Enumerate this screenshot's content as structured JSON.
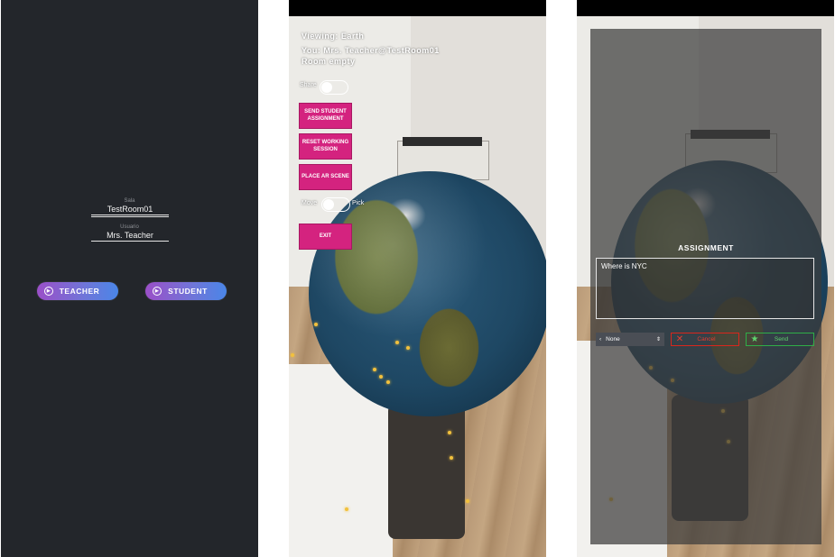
{
  "login": {
    "room_caption": "Sala",
    "room_value": "TestRoom01",
    "user_caption": "Usuario",
    "user_value": "Mrs. Teacher",
    "teacher_button": "TEACHER",
    "student_button": "STUDENT"
  },
  "ar": {
    "viewing": "Viewing: Earth",
    "you": "You: Mrs. Teacher@TestRoom01",
    "room_status": "Room empty",
    "share_label": "Share",
    "send_assignment_button": "SEND STUDENT ASSIGNMENT",
    "reset_session_button": "RESET WORKING SESSION",
    "place_scene_button": "PLACE AR SCENE",
    "move_label": "Move",
    "pick_label": "Pick",
    "exit_button": "EXIT"
  },
  "assignment": {
    "title": "ASSIGNMENT",
    "text": "Where is NYC",
    "select_value": "None",
    "cancel_button": "Cancel",
    "send_button": "Send"
  },
  "colors": {
    "login_bg": "#23262b",
    "accent_pink": "#d4237f",
    "cancel_red": "#d9261c",
    "send_green": "#2fae47"
  },
  "icons": [
    "play-circle-icon",
    "chevron-left-icon",
    "updown-arrows-icon",
    "close-x-icon",
    "star-icon"
  ]
}
